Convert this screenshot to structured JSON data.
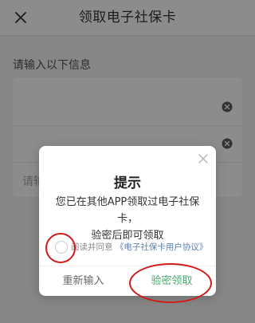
{
  "navbar": {
    "title": "领取电子社保卡",
    "close_icon": "close-icon"
  },
  "page": {
    "section_heading": "请输入以下信息",
    "fields": [
      {
        "placeholder": "",
        "has_clear": true
      },
      {
        "placeholder": "",
        "has_clear": true
      },
      {
        "placeholder": "请输",
        "has_clear": false
      }
    ]
  },
  "dialog": {
    "title": "提示",
    "message_line1": "您已在其他APP领取过电子社保卡，",
    "message_line2": "验密后即可领取",
    "agree_prefix": "阅读并同意",
    "agree_link": "《电子社保卡用户协议》",
    "agree_checked": false,
    "cancel_label": "重新输入",
    "confirm_label": "验密领取"
  },
  "colors": {
    "confirm": "#4aa86d",
    "link": "#5b7fb3",
    "annotation": "#d21b1b",
    "overlay": "rgba(0,0,0,0.45)"
  }
}
